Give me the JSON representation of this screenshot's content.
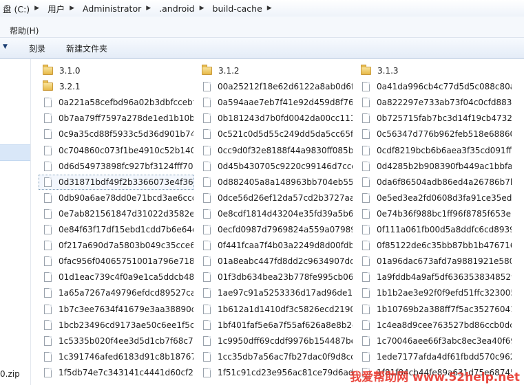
{
  "breadcrumb": [
    "盘 (C:)",
    "用户",
    "Administrator",
    ".android",
    "build-cache"
  ],
  "menu": {
    "help": "帮助(H)"
  },
  "toolbar": {
    "burn": "刻录",
    "new_folder": "新建文件夹"
  },
  "nav": {
    "zip_item": "0.zip"
  },
  "folders": [
    "3.1.0",
    "3.1.2",
    "3.1.3",
    "3.2.1"
  ],
  "files": [
    "00a25212f18e62d6122a8ab0d6f…",
    "0a41da996cb4c77d5d5c088c80a…",
    "0a221a58cefbd96a02b3dbfccebf…",
    "0a594aae7eb7f41e92d459d8f76…",
    "0a822297e733ab73f04c0cfd8832…",
    "0b7aa79ff7597a278de1ed1b10bf…",
    "0b181243d7b0fd0042da00cc111…",
    "0b725715fab7bc3d14f19cb47325…",
    "0c9a35cd88f5933c5d36d901b74…",
    "0c521c0d5d55c249dd5da5cc65f6…",
    "0c56347d776b962feb518e68860…",
    "0c704860c073f1be4910c52b140b…",
    "0cc9d0f32e8188f44a9830ff085b3…",
    "0cdf8219bcb6b6aea3f35cd091ff0…",
    "0d6d54973898fc927bf3124fff708…",
    "0d45b430705c9220c99146d7ccd…",
    "0d4285b2b908390fb449ac1bbfa…",
    "0d31871bdf49f2b3366073e4f367…",
    "0d882405a8a148963bb704eb556…",
    "0da6f86504adb86ed4a26786b7b…",
    "0db90a6ae78dd0e71bcd3ae6ccd…",
    "0dce56d26ef12da57cd2b3727aa…",
    "0e5ed3ea2fd0608d3fa91ce35ed1…",
    "0e7ab821561847d31022d3582e3…",
    "0e8cdf1814d43204e35fd39a5b69…",
    "0e74b36f988bc1ff96f8785f653e1…",
    "0e84f63f17df15ebd1cdd7b6e64e…",
    "0ecfd0987d7969824a559a07989…",
    "0f111a061fb00d5a8ddfc6cd8939…",
    "0f217a690d7a5803b049c35cce61…",
    "0f441fcaa7f4b03a2249d8d00fdb…",
    "0f85122de6c35bb87bb1b476716…",
    "0fac956f04065751001a796e7185…",
    "01a8eabc447fd8dd2c9634907dd…",
    "01a96dac673afd7a9881921e580…",
    "01d1eac739c4f0a9e1ca5ddcb486…",
    "01f3db634bea23b778fe995cb06c…",
    "1a9fddb4a9af5df6363538348529…",
    "1a65a7267a49796efdcd89527ca…",
    "1ae97c91a5253336d17ad96de17…",
    "1b1b2ae3e92f0f9efd51ffc323005…",
    "1b7c3ee7634f41679e3aa38890d…",
    "1b612a1d1410df3c5826ecd2190…",
    "1b10769b2a388ff7f5ac35276041…",
    "1bcb23496cd9173ae50c6ee1f5c4…",
    "1bf401faf5e6a7f55af626a8e8b2e…",
    "1c4ea8d9cee763527bd86ccb0dc…",
    "1c5335b020f4ee3d5d1cb7f68c73…",
    "1c9950dff69cddf9976b154487be…",
    "1c70046aee66f3abc8ec3ea40f69…",
    "1c391746afed6183d91c8b18767f…",
    "1cc35db7a56ac7fb27dac0f9d8cd…",
    "1ede7177afda4df61fbdd570c962…",
    "1f5db74e7c343141c4441d60cf26…",
    "1f51c91cd23e956ac81ce79d6ade…",
    "1f81f84cb44fe89a631d75e68745…"
  ],
  "watermark": "我爱帮助网 www.52help.net"
}
